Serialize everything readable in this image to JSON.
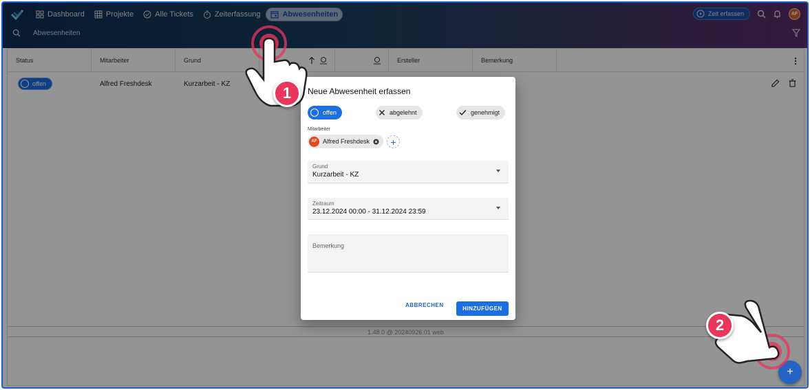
{
  "nav": {
    "items": [
      {
        "label": "Dashboard",
        "icon": "dashboard-icon"
      },
      {
        "label": "Projekte",
        "icon": "projects-grid-icon"
      },
      {
        "label": "Alle Tickets",
        "icon": "check-circle-icon"
      },
      {
        "label": "Zeiterfassung",
        "icon": "stopwatch-icon"
      },
      {
        "label": "Abwesenheiten",
        "icon": "calendar-icon",
        "active": true
      }
    ],
    "zeit_button": "Zeit erfassen",
    "avatar_initials": "AF"
  },
  "subbar": {
    "search_label": "Abwesenheiten"
  },
  "table": {
    "columns": [
      "Status",
      "Mitarbeiter",
      "Grund",
      "",
      "",
      "Ersteller",
      "Bemerkung"
    ],
    "rows": [
      {
        "status": "offen",
        "mitarbeiter": "Alfred Freshdesk",
        "grund": "Kurzarbeit - KZ"
      }
    ],
    "footer": "1.48.0 @ 20240926.01 web"
  },
  "dialog": {
    "title": "Neue Abwesenheit erfassen",
    "status_options": [
      {
        "label": "offen",
        "selected": true
      },
      {
        "label": "abgelehnt",
        "selected": false
      },
      {
        "label": "genehmigt",
        "selected": false
      }
    ],
    "employee_label": "Mitarbeiter",
    "employee": {
      "initials": "AF",
      "name": "Alfred Freshdesk"
    },
    "grund": {
      "label": "Grund",
      "value": "Kurzarbeit - KZ"
    },
    "zeitraum": {
      "label": "Zeitraum",
      "value": "23.12.2024 00:00 - 31.12.2024 23:59"
    },
    "bemerkung": {
      "label": "Bemerkung",
      "value": ""
    },
    "cancel_label": "ABBRECHEN",
    "submit_label": "HINZUFÜGEN"
  },
  "callouts": [
    {
      "number": "1"
    },
    {
      "number": "2"
    }
  ],
  "colors": {
    "accent": "#1d6fe0",
    "callout": "#e8365d"
  }
}
